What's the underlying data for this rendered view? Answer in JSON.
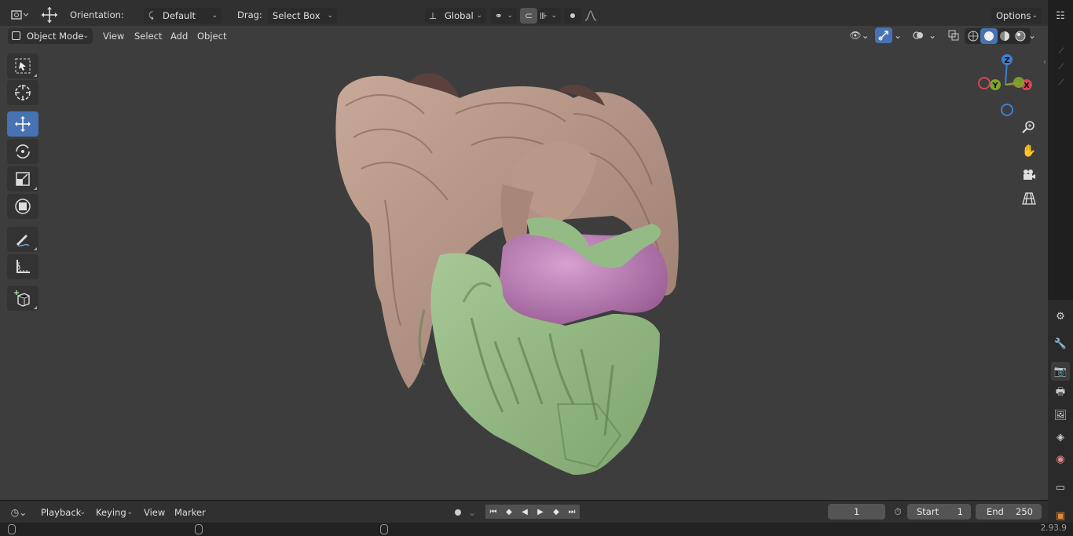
{
  "header": {
    "orientation_label": "Orientation:",
    "orientation_value": "Default",
    "drag_label": "Drag:",
    "drag_value": "Select Box",
    "transform_space": "Global",
    "options_label": "Options"
  },
  "view_header": {
    "mode": "Object Mode",
    "menus": [
      "View",
      "Select",
      "Add",
      "Object"
    ]
  },
  "toolbar": {
    "tools": [
      "select-box",
      "cursor",
      "move",
      "rotate",
      "scale",
      "transform",
      "annotate",
      "measure",
      "add-cube"
    ],
    "active_tool": "move"
  },
  "gizmo": {
    "x": "X",
    "y": "Y",
    "z": "Z"
  },
  "timeline": {
    "menus": [
      "Playback",
      "Keying",
      "View",
      "Marker"
    ],
    "current_frame": "1",
    "start_label": "Start",
    "start_value": "1",
    "end_label": "End",
    "end_value": "250"
  },
  "status": {
    "version": "2.93.9"
  },
  "colors": {
    "accent": "#4772b3",
    "hair": "#b8978a",
    "mask": "#8fb57e",
    "visor": "#b47bb0"
  }
}
